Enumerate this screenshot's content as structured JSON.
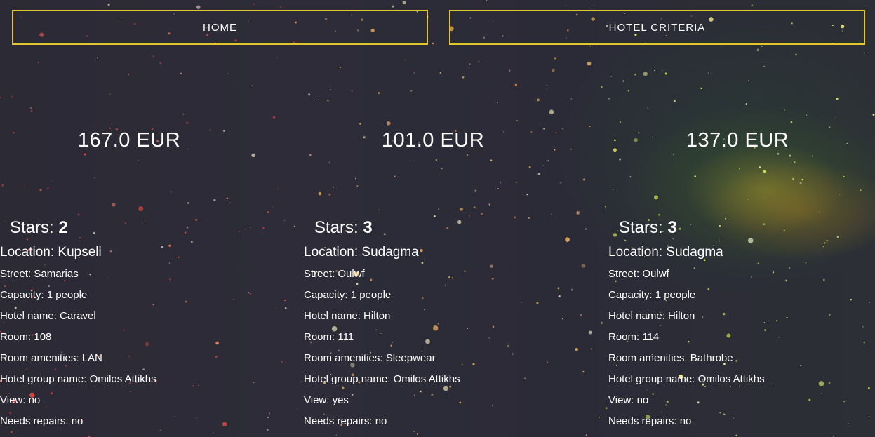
{
  "nav": {
    "home_label": "HOME",
    "criteria_label": "HOTEL CRITERIA"
  },
  "colors": {
    "accent_border": "#e5c62e",
    "background": "#2b2a35",
    "text": "#ffffff"
  },
  "rooms": [
    {
      "price": "167.0 EUR",
      "stars_label": "Stars:",
      "stars_value": "2",
      "location": "Location: Kupseli",
      "street": "Street: Samarias",
      "capacity": "Capacity: 1 people",
      "hotel_name": "Hotel name: Caravel",
      "room": "Room: 108",
      "amenities": "Room amenities: LAN",
      "group": "Hotel group name: Omilos Attikhs",
      "view": "View: no",
      "repairs": "Needs repairs: no"
    },
    {
      "price": "101.0 EUR",
      "stars_label": "Stars:",
      "stars_value": "3",
      "location": "Location: Sudagma",
      "street": "Street: Oulwf",
      "capacity": "Capacity: 1 people",
      "hotel_name": "Hotel name: Hilton",
      "room": "Room: 111",
      "amenities": "Room amenities: Sleepwear",
      "group": "Hotel group name: Omilos Attikhs",
      "view": "View: yes",
      "repairs": "Needs repairs: no"
    },
    {
      "price": "137.0 EUR",
      "stars_label": "Stars:",
      "stars_value": "3",
      "location": "Location: Sudagma",
      "street": "Street: Oulwf",
      "capacity": "Capacity: 1 people",
      "hotel_name": "Hotel name: Hilton",
      "room": "Room: 114",
      "amenities": "Room amenities: Bathrobe",
      "group": "Hotel group name: Omilos Attikhs",
      "view": "View: no",
      "repairs": "Needs repairs: no"
    }
  ]
}
